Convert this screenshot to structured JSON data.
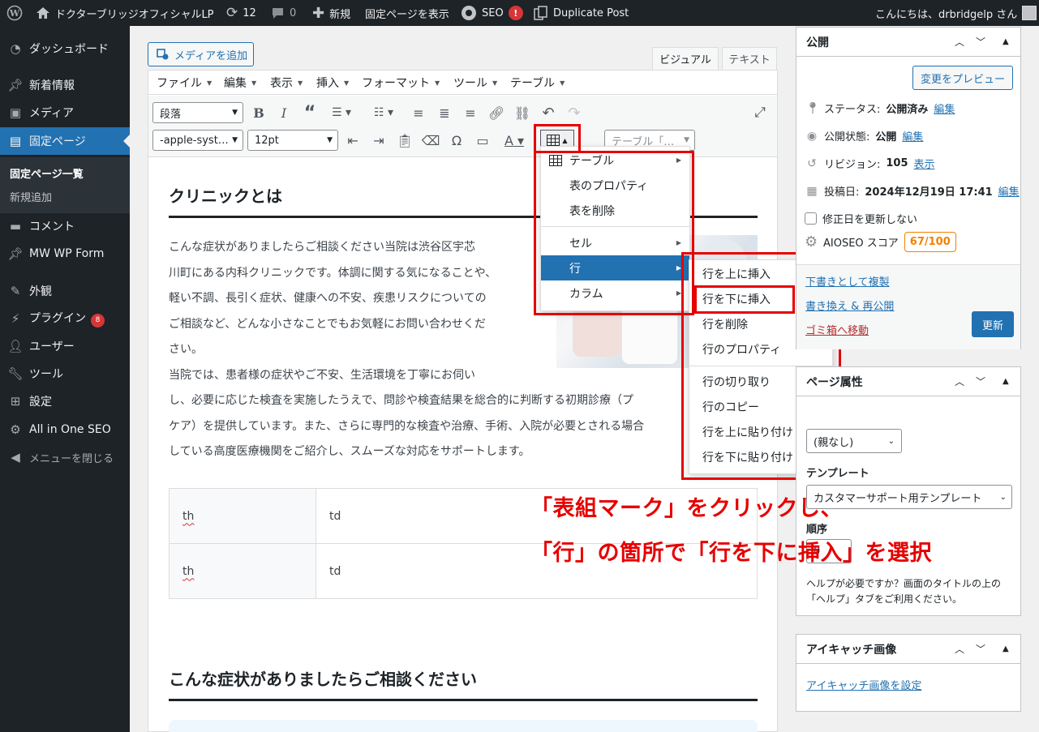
{
  "adminbar": {
    "site_name": "ドクターブリッジオフィシャルLP",
    "updates_count": "12",
    "comments_count": "0",
    "new_label": "新規",
    "view_page": "固定ページを表示",
    "seo_label": "SEO",
    "seo_alert": "!",
    "duplicate": "Duplicate Post",
    "greeting": "こんにちは、drbridgelp さん"
  },
  "sidebar": {
    "items": [
      {
        "label": "ダッシュボード",
        "icon": "dashboard-icon"
      },
      {
        "label": "新着情報",
        "icon": "pin-icon"
      },
      {
        "label": "メディア",
        "icon": "media-icon"
      },
      {
        "label": "固定ページ",
        "icon": "page-icon"
      },
      {
        "label": "コメント",
        "icon": "comment-icon"
      },
      {
        "label": "MW WP Form",
        "icon": "pin-icon"
      },
      {
        "label": "外観",
        "icon": "brush-icon"
      },
      {
        "label": "プラグイン",
        "icon": "plugin-icon",
        "badge": "8"
      },
      {
        "label": "ユーザー",
        "icon": "user-icon"
      },
      {
        "label": "ツール",
        "icon": "wrench-icon"
      },
      {
        "label": "設定",
        "icon": "settings-icon"
      },
      {
        "label": "All in One SEO",
        "icon": "aioseo-icon"
      }
    ],
    "submenu": [
      "固定ページ一覧",
      "新規追加"
    ],
    "collapse": "メニューを閉じる"
  },
  "editor": {
    "add_media": "メディアを追加",
    "tab_visual": "ビジュアル",
    "tab_text": "テキスト",
    "menubar": [
      "ファイル",
      "編集",
      "表示",
      "挿入",
      "フォーマット",
      "ツール",
      "テーブル"
    ],
    "format_select": "段落",
    "font_select": "-apple-syst…",
    "size_select": "12pt",
    "table_select": "テーブル「…"
  },
  "content": {
    "heading1": "クリニックとは",
    "para_lines": [
      "こんな症状がありましたらご相談ください当院は渋谷区宇芯",
      "川町にある内科クリニックです。体調に関する気になることや、",
      "軽い不調、長引く症状、健康への不安、疾患リスクについての",
      "ご相談など、どんな小さなことでもお気軽にお問い合わせくだ",
      "さい。",
      "当院では、患者様の症状やご不安、生活環境を丁寧にお伺い",
      "し、必要に応じた検査を実施したうえで、問診や検査結果を総合的に判断する初期診療（プ",
      "ケア）を提供しています。また、さらに専門的な検査や治療、手術、入院が必要とされる場合",
      "している高度医療機関をご紹介し、スムーズな対応をサポートします。"
    ],
    "table": [
      [
        "th",
        "td"
      ],
      [
        "th",
        "td"
      ]
    ],
    "heading2": "こんな症状がありましたらご相談ください"
  },
  "table_menu": {
    "items": [
      "テーブル",
      "表のプロパティ",
      "表を削除",
      "セル",
      "行",
      "カラム"
    ]
  },
  "row_menu": {
    "items": [
      "行を上に挿入",
      "行を下に挿入",
      "行を削除",
      "行のプロパティ",
      "行の切り取り",
      "行のコピー",
      "行を上に貼り付け",
      "行を下に貼り付け"
    ]
  },
  "annotation": {
    "line1": "「表組マーク」をクリックし、",
    "line2": "「行」の箇所で「行を下に挿入」を選択"
  },
  "publish": {
    "title": "公開",
    "preview": "変更をプレビュー",
    "status_label": "ステータス:",
    "status_value": "公開済み",
    "visibility_label": "公開状態:",
    "visibility_value": "公開",
    "revisions_label": "リビジョン:",
    "revisions_value": "105",
    "revisions_link": "表示",
    "date_label": "投稿日:",
    "date_value": "2024年12月19日 17:41",
    "edit": "編集",
    "modified_checkbox": "修正日を更新しない",
    "aioseo_label": "AIOSEO スコア",
    "aioseo_score": "67/100",
    "copy_draft": "下書きとして複製",
    "rewrite": "書き換え & 再公開",
    "trash": "ゴミ箱へ移動",
    "update": "更新"
  },
  "attributes": {
    "title": "ページ属性",
    "parent_value": "(親なし)",
    "template_label": "テンプレート",
    "template_value": "カスタマーサポート用テンプレート",
    "order_label": "順序",
    "order_value": "0",
    "help": "ヘルプが必要ですか？画面のタイトルの上の「ヘルプ」タブをご利用ください。"
  },
  "featured": {
    "title": "アイキャッチ画像",
    "set_link": "アイキャッチ画像を設定"
  },
  "colors": {
    "admin_dark": "#1d2327",
    "accent": "#2271b1",
    "annotation_red": "#e60000"
  }
}
